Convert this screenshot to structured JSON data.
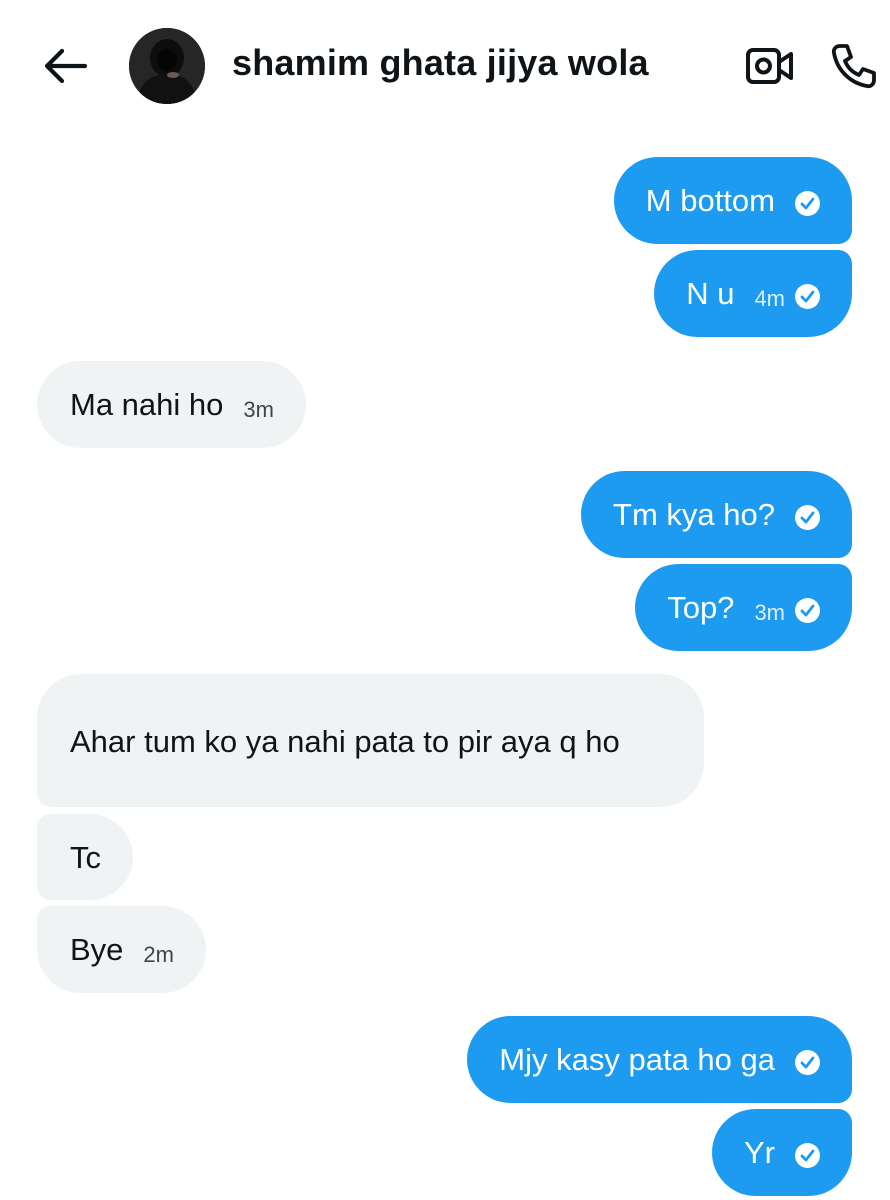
{
  "header": {
    "contact_name": "shamim ghata jijya wola",
    "back_icon": "arrow-left-icon",
    "video_icon": "video-camera-icon",
    "call_icon": "phone-icon"
  },
  "messages": [
    {
      "direction": "sent",
      "text": "M bottom",
      "time": "",
      "status": "read"
    },
    {
      "direction": "sent",
      "text": "N u",
      "time": "4m",
      "status": "read"
    },
    {
      "direction": "received",
      "text": "Ma nahi ho",
      "time": "3m"
    },
    {
      "direction": "sent",
      "text": "Tm kya ho?",
      "time": "",
      "status": "read"
    },
    {
      "direction": "sent",
      "text": "Top?",
      "time": "3m",
      "status": "read"
    },
    {
      "direction": "received",
      "text": "Ahar tum ko ya nahi pata to pir aya q ho",
      "time": ""
    },
    {
      "direction": "received",
      "text": "Tc",
      "time": ""
    },
    {
      "direction": "received",
      "text": "Bye",
      "time": "2m"
    },
    {
      "direction": "sent",
      "text": "Mjy kasy pata ho ga",
      "time": "",
      "status": "read"
    },
    {
      "direction": "sent",
      "text": "Yr",
      "time": "",
      "status": "read"
    }
  ],
  "colors": {
    "sent_bubble": "#1d9bf0",
    "received_bubble": "#eff3f4",
    "text_primary": "#0f1419"
  }
}
